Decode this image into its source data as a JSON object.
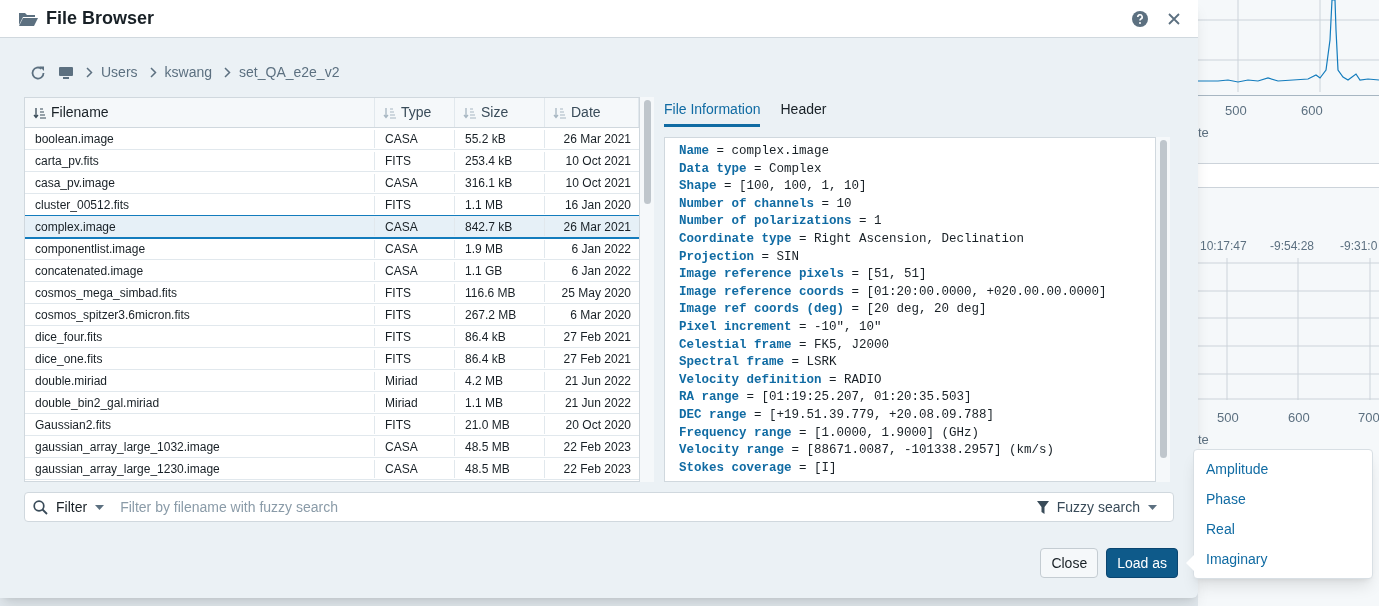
{
  "window": {
    "title": "File Browser"
  },
  "breadcrumb": [
    "Users",
    "kswang",
    "set_QA_e2e_v2"
  ],
  "table": {
    "columns": [
      {
        "label": "Filename",
        "sorted": true
      },
      {
        "label": "Type",
        "sorted": false
      },
      {
        "label": "Size",
        "sorted": false
      },
      {
        "label": "Date",
        "sorted": false
      }
    ],
    "rows": [
      {
        "name": "boolean.image",
        "type": "CASA",
        "size": "55.2 kB",
        "date": "26 Mar 2021",
        "selected": false
      },
      {
        "name": "carta_pv.fits",
        "type": "FITS",
        "size": "253.4 kB",
        "date": "10 Oct 2021",
        "selected": false
      },
      {
        "name": "casa_pv.image",
        "type": "CASA",
        "size": "316.1 kB",
        "date": "10 Oct 2021",
        "selected": false
      },
      {
        "name": "cluster_00512.fits",
        "type": "FITS",
        "size": "1.1 MB",
        "date": "16 Jan 2020",
        "selected": false
      },
      {
        "name": "complex.image",
        "type": "CASA",
        "size": "842.7 kB",
        "date": "26 Mar 2021",
        "selected": true
      },
      {
        "name": "componentlist.image",
        "type": "CASA",
        "size": "1.9 MB",
        "date": "6 Jan 2022",
        "selected": false
      },
      {
        "name": "concatenated.image",
        "type": "CASA",
        "size": "1.1 GB",
        "date": "6 Jan 2022",
        "selected": false
      },
      {
        "name": "cosmos_mega_simbad.fits",
        "type": "FITS",
        "size": "116.6 MB",
        "date": "25 May 2020",
        "selected": false
      },
      {
        "name": "cosmos_spitzer3.6micron.fits",
        "type": "FITS",
        "size": "267.2 MB",
        "date": "6 Mar 2020",
        "selected": false
      },
      {
        "name": "dice_four.fits",
        "type": "FITS",
        "size": "86.4 kB",
        "date": "27 Feb 2021",
        "selected": false
      },
      {
        "name": "dice_one.fits",
        "type": "FITS",
        "size": "86.4 kB",
        "date": "27 Feb 2021",
        "selected": false
      },
      {
        "name": "double.miriad",
        "type": "Miriad",
        "size": "4.2 MB",
        "date": "21 Jun 2022",
        "selected": false
      },
      {
        "name": "double_bin2_gal.miriad",
        "type": "Miriad",
        "size": "1.1 MB",
        "date": "21 Jun 2022",
        "selected": false
      },
      {
        "name": "Gaussian2.fits",
        "type": "FITS",
        "size": "21.0 MB",
        "date": "20 Oct 2020",
        "selected": false
      },
      {
        "name": "gaussian_array_large_1032.image",
        "type": "CASA",
        "size": "48.5 MB",
        "date": "22 Feb 2023",
        "selected": false
      },
      {
        "name": "gaussian_array_large_1230.image",
        "type": "CASA",
        "size": "48.5 MB",
        "date": "22 Feb 2023",
        "selected": false
      }
    ]
  },
  "info_tabs": [
    {
      "label": "File Information",
      "selected": true
    },
    {
      "label": "Header",
      "selected": false
    }
  ],
  "file_info": [
    "**Name** = complex.image",
    "**Data type** = Complex",
    "**Shape** = [100, 100, 1, 10]",
    "**Number of channels** = 10",
    "**Number of polarizations** = 1",
    "**Coordinate type** = Right Ascension, Declination",
    "**Projection** = SIN",
    "**Image reference pixels** = [51, 51]",
    "**Image reference coords** = [01:20:00.0000, +020.00.00.0000]",
    "**Image ref coords (deg)** = [20 deg, 20 deg]",
    "**Pixel increment** = -10\", 10\"",
    "**Celestial frame** = FK5, J2000",
    "**Spectral frame** = LSRK",
    "**Velocity definition** = RADIO",
    "**RA range** = [01:19:25.207, 01:20:35.503]",
    "**DEC range** = [+19.51.39.779, +20.08.09.788]",
    "**Frequency range** = [1.0000, 1.9000] (GHz)",
    "**Velocity range** = [88671.0087, -101338.2957] (km/s)",
    "**Stokes coverage** = [I]"
  ],
  "filter": {
    "label": "Filter",
    "placeholder": "Filter by filename with fuzzy search",
    "mode": "Fuzzy search"
  },
  "buttons": [
    "Close",
    "Load as"
  ],
  "load_menu": [
    "Amplitude",
    "Phase",
    "Real",
    "Imaginary"
  ],
  "background": {
    "top_ticks": [
      "500",
      "600"
    ],
    "top_label": "te",
    "coord_ticks": [
      "10:17:47",
      "-9:54:28",
      "-9:31:0"
    ],
    "bottom_ticks": [
      "500",
      "600",
      "700"
    ],
    "bottom_label": "te"
  }
}
